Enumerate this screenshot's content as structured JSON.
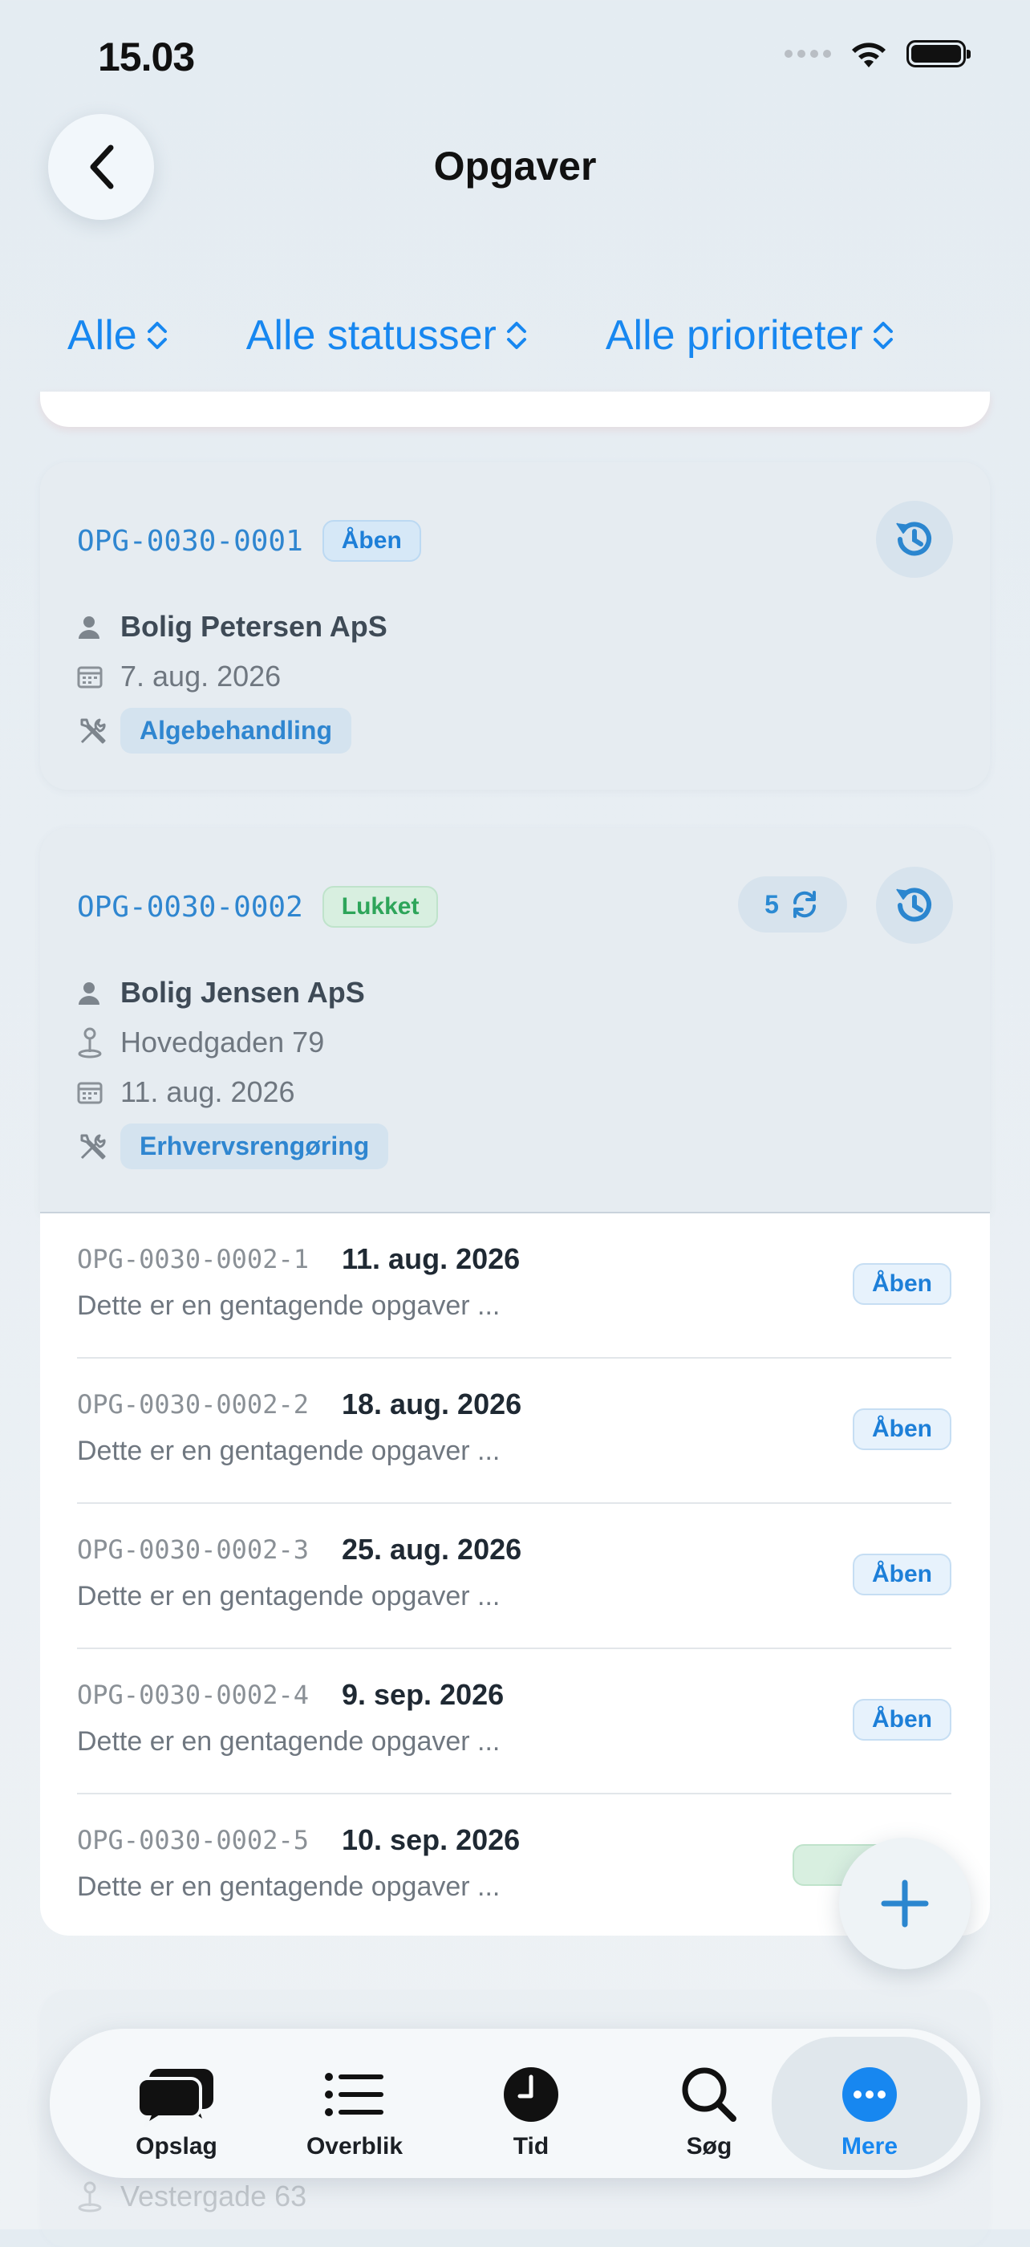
{
  "status_bar": {
    "time": "15.03"
  },
  "header": {
    "title": "Opgaver"
  },
  "filters": [
    {
      "label": "Alle"
    },
    {
      "label": "Alle statusser"
    },
    {
      "label": "Alle prioriteter"
    }
  ],
  "tasks": [
    {
      "code": "OPG-0030-0001",
      "status": "Åben",
      "customer": "Bolig Petersen ApS",
      "date": "7. aug. 2026",
      "category": "Algebehandling"
    },
    {
      "code": "OPG-0030-0002",
      "status": "Lukket",
      "recurrence_count": "5",
      "customer": "Bolig Jensen ApS",
      "address": "Hovedgaden 79",
      "date": "11. aug. 2026",
      "category": "Erhvervsrengøring",
      "occurrences": [
        {
          "id": "OPG-0030-0002-1",
          "date": "11. aug. 2026",
          "desc": "Dette er en gentagende opgaver ...",
          "status": "Åben"
        },
        {
          "id": "OPG-0030-0002-2",
          "date": "18. aug. 2026",
          "desc": "Dette er en gentagende opgaver ...",
          "status": "Åben"
        },
        {
          "id": "OPG-0030-0002-3",
          "date": "25. aug. 2026",
          "desc": "Dette er en gentagende opgaver ...",
          "status": "Åben"
        },
        {
          "id": "OPG-0030-0002-4",
          "date": "9. sep. 2026",
          "desc": "Dette er en gentagende opgaver ...",
          "status": "Åben"
        },
        {
          "id": "OPG-0030-0002-5",
          "date": "10. sep. 2026",
          "desc": "Dette er en gentagende opgaver ...",
          "status": ""
        }
      ]
    }
  ],
  "background_card": {
    "address": "Vestergade 63"
  },
  "tabbar": [
    {
      "label": "Opslag",
      "icon": "chat-bubbles-icon"
    },
    {
      "label": "Overblik",
      "icon": "list-icon"
    },
    {
      "label": "Tid",
      "icon": "clock-icon"
    },
    {
      "label": "Søg",
      "icon": "search-icon"
    },
    {
      "label": "Mere",
      "icon": "more-icon",
      "active": true
    }
  ],
  "colors": {
    "accent": "#1787f0",
    "open": "#1d7fd8",
    "closed": "#2ea55a"
  }
}
